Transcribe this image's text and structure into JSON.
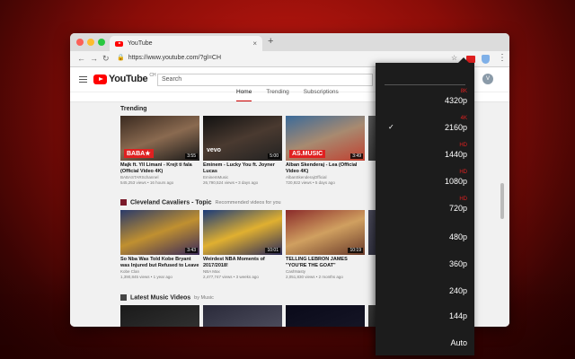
{
  "browser": {
    "tab_title": "YouTube",
    "tab_close": "×",
    "new_tab": "+",
    "url_lock": "🔒",
    "url": "https://www.youtube.com/?gl=CH",
    "back": "←",
    "forward": "→",
    "reload": "↻",
    "star": "☆",
    "menu": "⋮"
  },
  "youtube": {
    "logo_text": "YouTube",
    "logo_country": "CH",
    "search_placeholder": "Search",
    "avatar_letter": "V",
    "tabs": [
      {
        "label": "Home"
      },
      {
        "label": "Trending"
      },
      {
        "label": "Subscriptions"
      }
    ],
    "sections": [
      {
        "title": "Trending",
        "subtitle": "",
        "videos": [
          {
            "title": "Majk ft. Yll Limani - Krejt ti fala (Official Video 4K)",
            "channel": "BABASTARSchannel",
            "meta": "545,253 views • 16 hours ago",
            "duration": "3:55",
            "label": "BABA★"
          },
          {
            "title": "Eminem - Lucky You ft. Joyner Lucas",
            "channel": "EminemMusic",
            "meta": "26,790,524 views • 3 days ago",
            "duration": "5:00",
            "label": "vevo"
          },
          {
            "title": "Alban Skenderaj - Lea (Official Video 4K)",
            "channel": "AlbanSkenderajOfficial",
            "meta": "720,922 views • 5 days ago",
            "duration": "3:49",
            "label": "AS.MUSIC"
          },
          {
            "title": "",
            "channel": "",
            "meta": "",
            "duration": "",
            "label": ""
          }
        ]
      },
      {
        "title": "Cleveland Cavaliers - Topic",
        "subtitle": "Recommended videos for you",
        "videos": [
          {
            "title": "So Nba Was Told Kobe Bryant was Injured but Refused to Leave",
            "channel": "Kobe Clan",
            "meta": "1,390,845 views • 1 year ago",
            "duration": "3:43",
            "label": ""
          },
          {
            "title": "Weirdest NBA Moments of 2017/2018!",
            "channel": "NBA Max",
            "meta": "2,477,747 views • 3 weeks ago",
            "duration": "10:01",
            "label": ""
          },
          {
            "title": "TELLING LEBRON JAMES \"YOU'RE THE GOAT\"",
            "channel": "CashNasty",
            "meta": "2,051,830 views • 2 months ago",
            "duration": "10:19",
            "label": ""
          },
          {
            "title": "",
            "channel": "",
            "meta": "",
            "duration": "",
            "label": ""
          }
        ]
      },
      {
        "title": "Latest Music Videos",
        "subtitle": "by Music",
        "videos": [
          {
            "title": "",
            "channel": "",
            "meta": "",
            "duration": "",
            "label": ""
          },
          {
            "title": "",
            "channel": "",
            "meta": "",
            "duration": "",
            "label": ""
          },
          {
            "title": "",
            "channel": "",
            "meta": "",
            "duration": "",
            "label": ""
          },
          {
            "title": "",
            "channel": "",
            "meta": "",
            "duration": "",
            "label": ""
          }
        ]
      }
    ]
  },
  "quality_menu": {
    "selected": "2160p",
    "check_mark": "✓",
    "items": [
      {
        "label": "4320p",
        "badge": "8K"
      },
      {
        "label": "2160p",
        "badge": "4K"
      },
      {
        "label": "1440p",
        "badge": "HD"
      },
      {
        "label": "1080p",
        "badge": "HD"
      },
      {
        "label": "720p",
        "badge": "HD"
      },
      {
        "label": "480p",
        "badge": ""
      },
      {
        "label": "360p",
        "badge": ""
      },
      {
        "label": "240p",
        "badge": ""
      },
      {
        "label": "144p",
        "badge": ""
      },
      {
        "label": "Auto",
        "badge": ""
      }
    ]
  },
  "colors": {
    "yt_red": "#ff0000",
    "badge_red": "#e02020",
    "panel_bg": "#1c1c1c"
  }
}
